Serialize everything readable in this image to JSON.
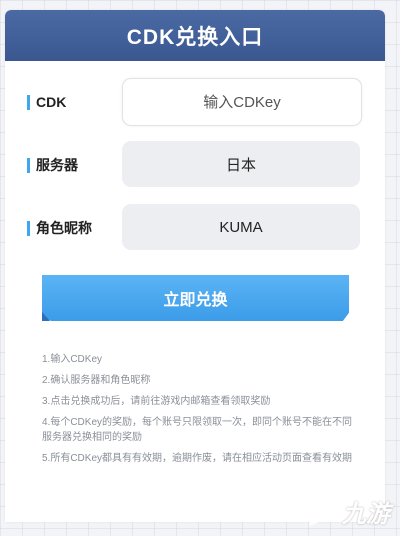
{
  "header": {
    "title": "CDK兑换入口"
  },
  "form": {
    "cdk": {
      "label": "CDK",
      "placeholder": "输入CDKey"
    },
    "server": {
      "label": "服务器",
      "value": "日本"
    },
    "nickname": {
      "label": "角色昵称",
      "value": "KUMA"
    },
    "submit_label": "立即兑换"
  },
  "notes": [
    "1.输入CDKey",
    "2.确认服务器和角色昵称",
    "3.点击兑换成功后，请前往游戏内邮箱查看领取奖励",
    "4.每个CDKey的奖励，每个账号只限领取一次，即同个账号不能在不同服务器兑换相同的奖励",
    "5.所有CDKey都具有有效期，逾期作废，请在相应活动页面查看有效期"
  ],
  "watermark": {
    "text": "九游"
  },
  "colors": {
    "header_bg": "#4563a0",
    "accent": "#3da7f0",
    "button_bg": "#4aa8ef"
  }
}
